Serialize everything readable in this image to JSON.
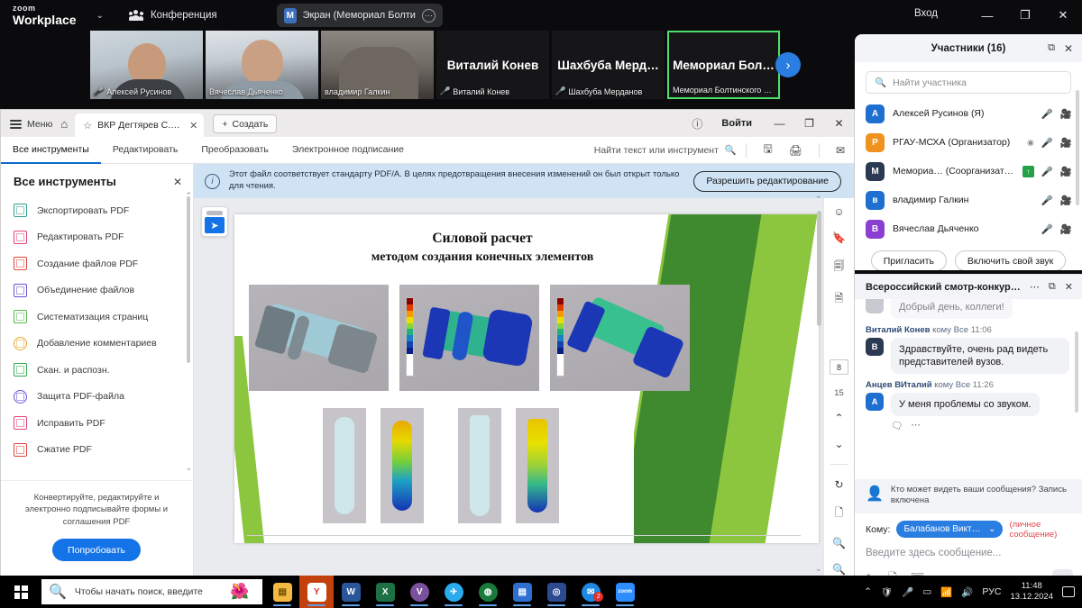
{
  "zoom_window": {
    "brand_line1": "zoom",
    "brand_line2": "Workplace",
    "meeting_label": "Конференция",
    "screen_pill": {
      "badge": "M",
      "label": "Экран (Мемориал Болтинскогс",
      "more": "⋯"
    },
    "sign_in": "Вход",
    "window_controls": {
      "minimize": "—",
      "maximize": "❐",
      "close": "✕"
    },
    "next_page_arrow": "›",
    "tiles": [
      {
        "name": "Алексей Русинов",
        "muted": true,
        "type": "video"
      },
      {
        "name": "Вячеслав Дьяченко",
        "muted": false,
        "type": "video"
      },
      {
        "name": "владимир Галкин",
        "muted": false,
        "type": "video"
      },
      {
        "name": "Виталий Конев",
        "display": "Виталий Конев",
        "muted": true,
        "type": "name"
      },
      {
        "name": "Шахбуба Мерданов",
        "display": "Шахбуба Мерд…",
        "muted": true,
        "type": "name"
      },
      {
        "name": "Мемориал Болтинского …",
        "display": "Мемориал  Бол…",
        "muted": false,
        "type": "name",
        "active": true
      }
    ]
  },
  "acrobat": {
    "menu_label": "Меню",
    "tab": {
      "label": "ВКР Дегтярев С.Н п…",
      "close": "✕"
    },
    "new_tab": {
      "plus": "+",
      "label": "Создать"
    },
    "help": "?",
    "login": "Войти",
    "window_controls": {
      "minimize": "—",
      "maximize": "❐",
      "close": "✕"
    },
    "toolbar_tabs": [
      {
        "label": "Все инструменты",
        "active": true
      },
      {
        "label": "Редактировать",
        "active": false
      },
      {
        "label": "Преобразовать",
        "active": false
      },
      {
        "label": "Электронное подписание",
        "active": false
      }
    ],
    "search_placeholder": "Найти текст или инструмент",
    "toolbar_icons": [
      "save-icon",
      "print-icon",
      "mail-icon"
    ],
    "tools_panel": {
      "title": "Все инструменты",
      "close": "✕",
      "items": [
        {
          "label": "Экспортировать PDF",
          "color": "#2d9e8f"
        },
        {
          "label": "Редактировать PDF",
          "color": "#e0457b"
        },
        {
          "label": "Создание файлов PDF",
          "color": "#e0453c"
        },
        {
          "label": "Объединение файлов",
          "color": "#6b4fd8"
        },
        {
          "label": "Систематизация страниц",
          "color": "#57b84a"
        },
        {
          "label": "Добавление комментариев",
          "color": "#e0a82e"
        },
        {
          "label": "Скан. и распозн.",
          "color": "#2fa84f"
        },
        {
          "label": "Защита PDF-файла",
          "color": "#6b4fd8"
        },
        {
          "label": "Исправить PDF",
          "color": "#e0457b"
        },
        {
          "label": "Сжатие PDF",
          "color": "#e0453c"
        }
      ],
      "promo_text": "Конвертируйте, редактируйте и электронно подписывайте формы и соглашения PDF",
      "promo_button": "Попробовать"
    },
    "pdfa_notice": {
      "text": "Этот файл соответствует стандарту PDF/A. В целях предотвращения внесения изменений он был открыт только для чтения.",
      "button": "Разрешить редактирование"
    },
    "page_nav": {
      "current": "8",
      "total": "15",
      "up": "⌃",
      "down": "⌄"
    },
    "right_rail_icons": [
      "comment-icon",
      "bookmark-icon",
      "copy-pages-icon",
      "protect-icon",
      "rotate-icon",
      "export-icon",
      "zoom-in-icon",
      "zoom-out-icon"
    ],
    "document": {
      "title_line1": "Силовой расчет",
      "title_line2": "методом создания конечных элементов"
    }
  },
  "participants_panel": {
    "title": "Участники (16)",
    "popout": "⧉",
    "close": "✕",
    "search_placeholder": "Найти участника",
    "rows": [
      {
        "initial": "А",
        "color": "#1f6fd0",
        "name": "Алексей Русинов (Я)",
        "mic": "muted",
        "cam": "on",
        "chip": null,
        "rec": false
      },
      {
        "initial": "Р",
        "color": "#f0921f",
        "name": "РГАУ-МСХА (Организатор)",
        "mic": "muted",
        "cam": "off",
        "chip": null,
        "rec": true
      },
      {
        "initial": "М",
        "color": "#2b3a52",
        "name": "Мемориа… (Соорганизатор)",
        "mic": "on",
        "cam": "off",
        "chip": "↑",
        "rec": false
      },
      {
        "initial": "в",
        "color": "#1f6fd0",
        "name": "владимир Галкин",
        "mic": "on",
        "cam": "on",
        "chip": null,
        "rec": false
      },
      {
        "initial": "В",
        "color": "#8b3fd0",
        "name": "Вячеслав Дьяченко",
        "mic": "on",
        "cam": "on",
        "chip": null,
        "rec": false
      }
    ],
    "buttons": [
      "Пригласить",
      "Включить свой звук"
    ]
  },
  "chat_panel": {
    "title": "Всероссийский смотр-конкурс в…",
    "more": "⋯",
    "popout": "⧉",
    "close": "✕",
    "cut_message": "Добрый день, коллеги!",
    "messages": [
      {
        "author": "Виталий Конев",
        "to": "кому Все",
        "time": "11:06",
        "initial": "В",
        "color": "#2b3a52",
        "text": "Здравствуйте, очень рад видеть представителей вузов."
      },
      {
        "author": "Анцев ВИталий",
        "to": "кому Все",
        "time": "11:26",
        "initial": "А",
        "color": "#1f6fd0",
        "text": "У меня проблемы со звуком."
      }
    ],
    "actions": [
      "react-icon",
      "more-icon"
    ],
    "notice": "Кто может видеть ваши сообщения? Запись включена",
    "to_label": "Кому:",
    "to_value": "Балабанов Виктор …",
    "to_caret": "⌄",
    "private_label": "(личное сообщение)",
    "input_placeholder": "Введите здесь сообщение...",
    "tools": [
      "format-icon",
      "file-icon",
      "screenshot-icon",
      "chevron-down-icon"
    ],
    "send": "➤"
  },
  "taskbar": {
    "search_placeholder": "Чтобы начать поиск, введите",
    "apps": [
      {
        "name": "file-explorer",
        "color": "#f5b942",
        "glyph": "▤",
        "underline": true
      },
      {
        "name": "yandex-browser",
        "color": "#ffffff",
        "glyph": "Y",
        "active": true,
        "underline": true
      },
      {
        "name": "word",
        "color": "#2b579a",
        "glyph": "W",
        "underline": true
      },
      {
        "name": "excel",
        "color": "#1e7145",
        "glyph": "X",
        "underline": true
      },
      {
        "name": "viber",
        "color": "#7b519d",
        "glyph": "V",
        "underline": true
      },
      {
        "name": "telegram",
        "color": "#2aabee",
        "glyph": "✈",
        "underline": true
      },
      {
        "name": "kaspersky",
        "color": "#1a7a3c",
        "glyph": "◍",
        "underline": true
      },
      {
        "name": "save-app",
        "color": "#2f6fd0",
        "glyph": "💾",
        "underline": true
      },
      {
        "name": "blue-app",
        "color": "#2b4a8f",
        "glyph": "◎",
        "underline": true
      },
      {
        "name": "mail",
        "color": "#1e88e5",
        "glyph": "✉",
        "badge": "2",
        "underline": true
      },
      {
        "name": "zoom",
        "color": "#2d8cff",
        "glyph": "zoom",
        "underline": true
      }
    ],
    "tray": {
      "chevron": "⌃",
      "icons": [
        "shield-icon",
        "mic-icon",
        "battery-icon",
        "wifi-icon",
        "volume-icon"
      ],
      "lang": "РУС"
    },
    "clock": {
      "time": "11:48",
      "date": "13.12.2024"
    },
    "notifications": "notification-icon"
  }
}
